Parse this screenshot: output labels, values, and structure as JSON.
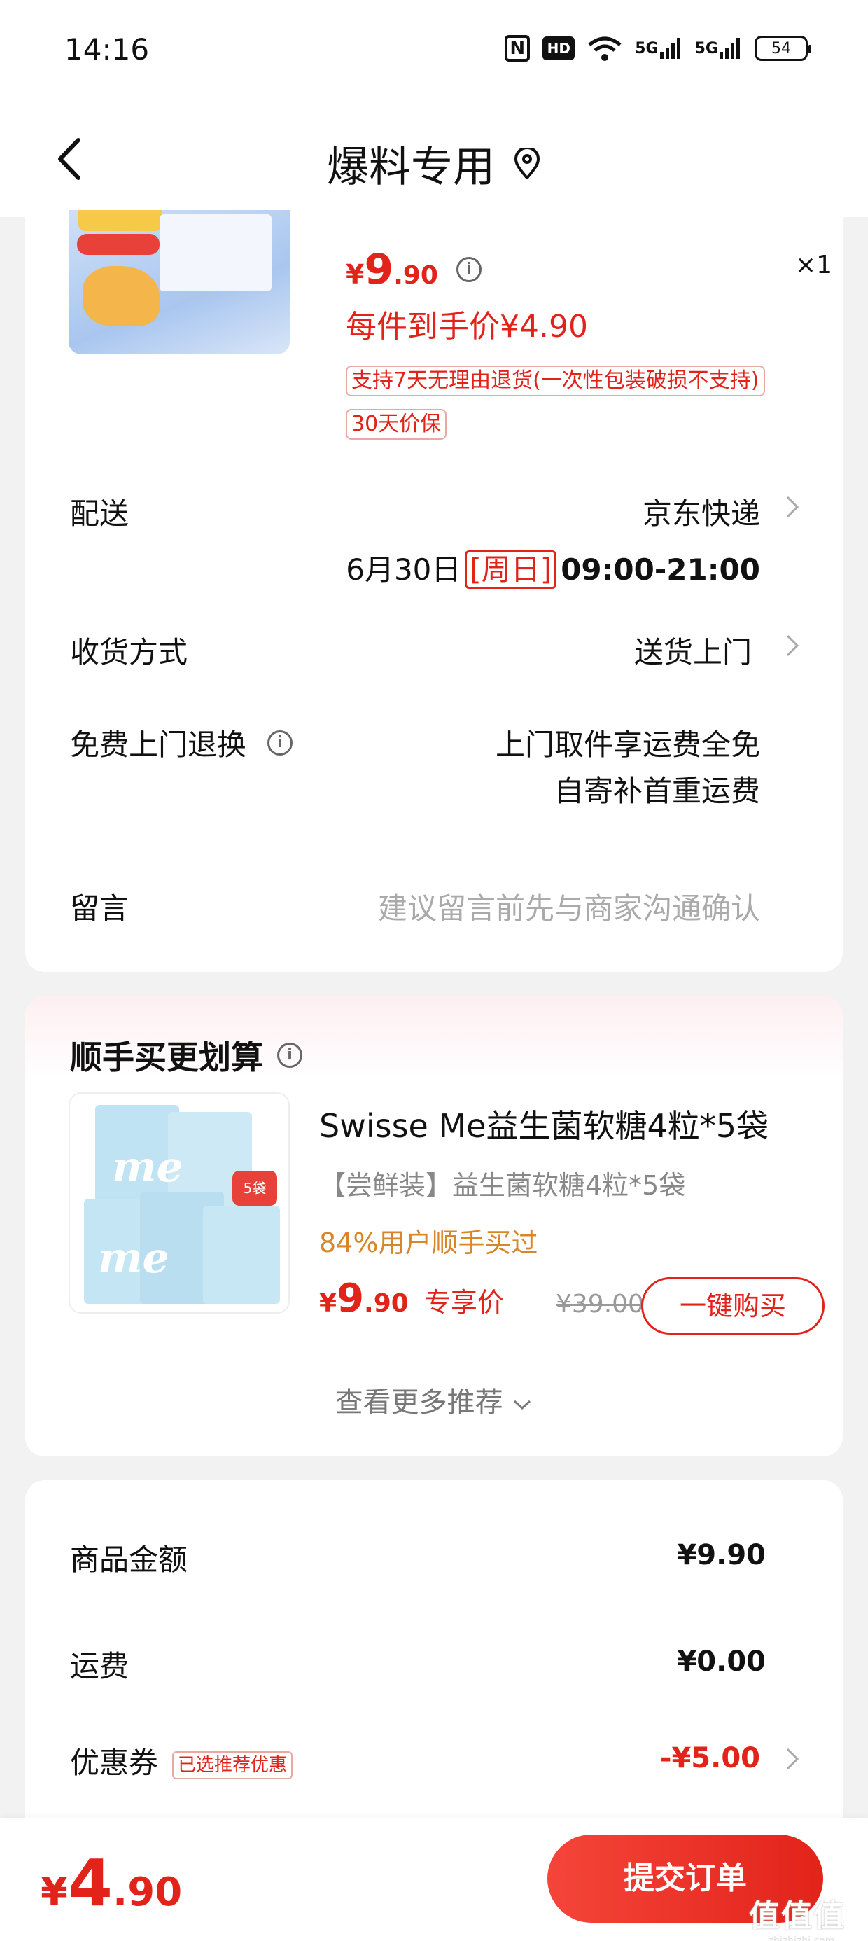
{
  "status_bar": {
    "time": "14:16",
    "hd_label": "HD",
    "signal1": "5G",
    "signal2": "5G",
    "battery": "54"
  },
  "header": {
    "title": "爆料专用"
  },
  "product": {
    "price_yen": "¥",
    "price_int": "9",
    "price_dec": ".90",
    "quantity": "×1",
    "arrive_price": "每件到手价¥4.90",
    "policies": [
      "支持7天无理由退货(一次性包装破损不支持)",
      "30天价保"
    ]
  },
  "delivery": {
    "label": "配送",
    "carrier": "京东快递",
    "date": "6月30日",
    "weekday": "[周日]",
    "time_range": "09:00-21:00"
  },
  "receive": {
    "label": "收货方式",
    "value": "送货上门"
  },
  "free_return": {
    "label": "免费上门退换",
    "line1": "上门取件享运费全免",
    "line2": "自寄补首重运费"
  },
  "message": {
    "label": "留言",
    "placeholder": "建议留言前先与商家沟通确认"
  },
  "recommend": {
    "title": "顺手买更划算",
    "product_name": "Swisse Me益生菌软糖4粒*5袋",
    "subtitle": "【尝鲜装】益生菌软糖4粒*5袋",
    "stat": "84%用户顺手买过",
    "price_yen": "¥",
    "price_int": "9",
    "price_dec": ".90",
    "exclusive": "专享价",
    "original_price": "¥39.00",
    "buy_button": "一键购买",
    "more": "查看更多推荐"
  },
  "summary": {
    "goods_label": "商品金额",
    "goods_value": "¥9.90",
    "shipping_label": "运费",
    "shipping_value": "¥0.00",
    "coupon_label": "优惠券",
    "coupon_tag": "已选推荐优惠",
    "coupon_value": "-¥5.00"
  },
  "bottom": {
    "total_yen": "¥",
    "total_int": "4",
    "total_dec": ".90",
    "submit": "提交订单"
  },
  "watermark": {
    "main": "值值值",
    "sub": "zhizhizhi.com"
  },
  "colors": {
    "accent": "#e2231a",
    "orange_stat": "#d8862a",
    "background": "#f2f2f2"
  }
}
